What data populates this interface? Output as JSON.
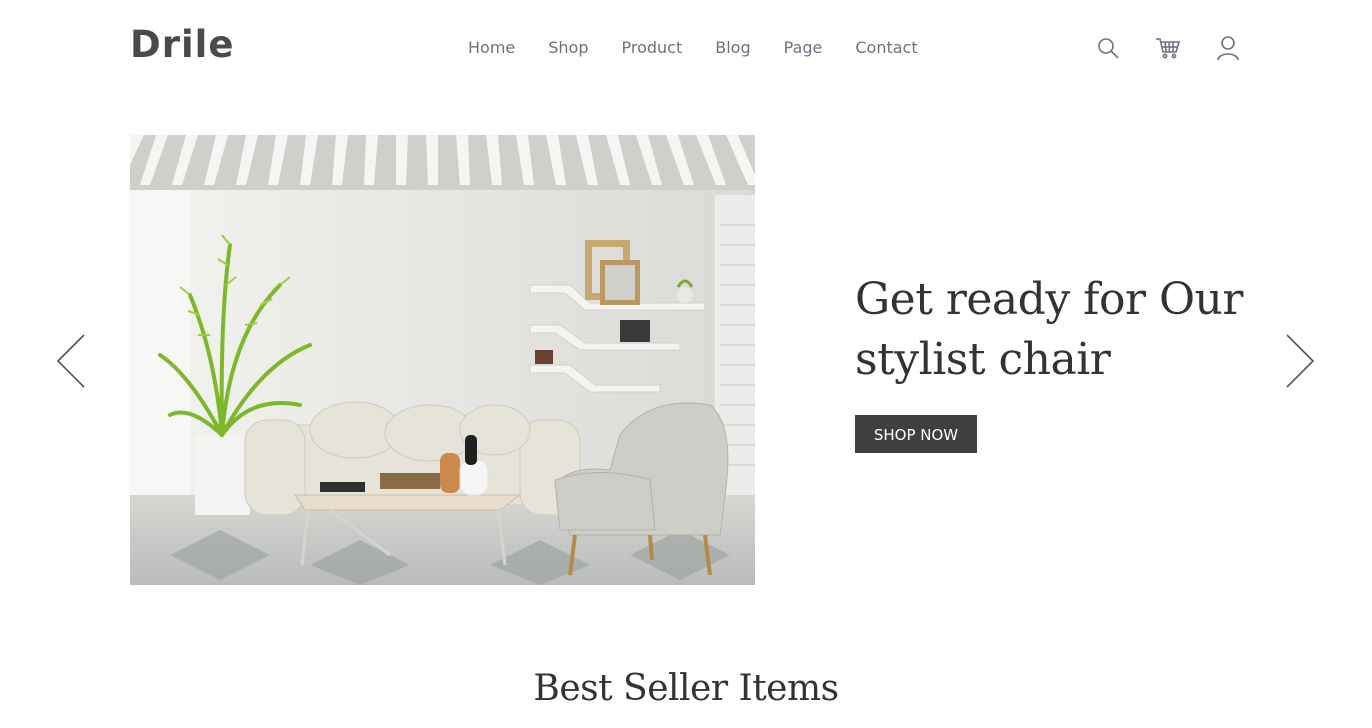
{
  "header": {
    "logo": "Drile",
    "nav": [
      {
        "label": "Home"
      },
      {
        "label": "Shop"
      },
      {
        "label": "Product"
      },
      {
        "label": "Blog"
      },
      {
        "label": "Page"
      },
      {
        "label": "Contact"
      }
    ],
    "icons": [
      "search-icon",
      "cart-icon",
      "user-icon"
    ]
  },
  "hero": {
    "title_line1": "Get ready for Our",
    "title_line2": "stylist chair",
    "button_label": "SHOP NOW",
    "image": "living room interior with sofa, armchair, coffee table, plant and wall shelves"
  },
  "section": {
    "title": "Best Seller Items"
  },
  "colors": {
    "text": "#333333",
    "nav_text": "#6b7280",
    "button_bg": "#3f3f3f",
    "button_text": "#ffffff"
  }
}
